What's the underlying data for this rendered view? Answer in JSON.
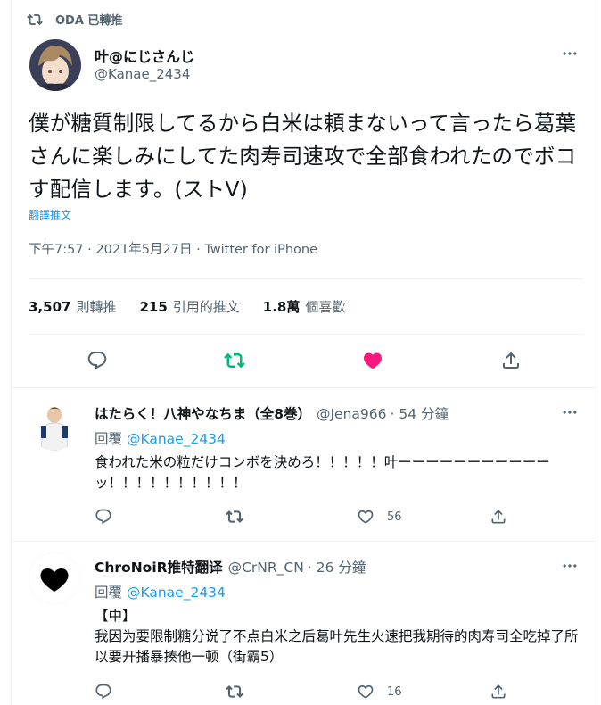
{
  "retweet_banner": "ODA 已轉推",
  "main": {
    "name": "叶@にじさんじ",
    "handle": "@Kanae_2434",
    "text": "僕が糖質制限してるから白米は頼まないって言ったら葛葉さんに楽しみにしてた肉寿司速攻で全部食われたのでボコす配信します。(ストV)",
    "translate": "翻譯推文",
    "meta": "下午7:57 · 2021年5月27日 · Twitter for iPhone",
    "stats": [
      {
        "value": "3,507",
        "label": "則轉推"
      },
      {
        "value": "215",
        "label": "引用的推文"
      },
      {
        "value": "1.8萬",
        "label": "個喜歡"
      }
    ]
  },
  "replies": [
    {
      "name": "はたらく！八神やなちま（全8巻）",
      "handle": "@Jena966",
      "time": "· 54 分鐘",
      "replying_prefix": "回覆",
      "replying_to": "@Kanae_2434",
      "text": "食われた米の粒だけコンボを決めろ！！！！！叶ーーーーーーーーーーーッ！！！！！！！！！！",
      "likes": "56"
    },
    {
      "name": "ChroNoiR推特翻译",
      "handle": "@CrNR_CN",
      "time": "· 26 分鐘",
      "replying_prefix": "回覆",
      "replying_to": "@Kanae_2434",
      "text_line1": "【中】",
      "text_line2": "我因为要限制糖分说了不点白米之后葛叶先生火速把我期待的肉寿司全吃掉了所以要开播暴揍他一顿（街霸5）",
      "likes": "16"
    }
  ],
  "colors": {
    "primary_text": "#0f1419",
    "secondary_text": "#536471",
    "link_blue": "#1d9bf0",
    "retweet_green": "#00ba7c",
    "like_pink": "#f91880",
    "divider": "#eff3f4"
  }
}
